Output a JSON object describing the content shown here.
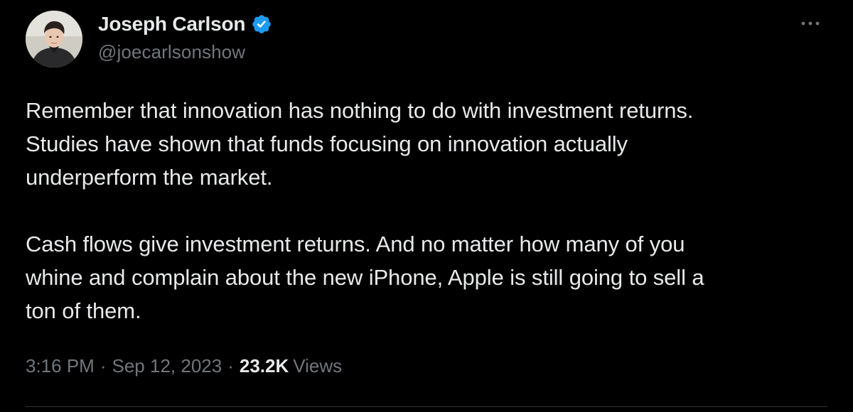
{
  "author": {
    "display_name": "Joseph Carlson",
    "handle": "@joecarlsonshow",
    "verified": true,
    "verified_color": "#1d9bf0"
  },
  "tweet": {
    "paragraphs": [
      "Remember that innovation has nothing to do with investment returns.\nStudies have shown that funds focusing on innovation actually\nunderperform the market.",
      "Cash flows give investment returns. And no matter how many of you\nwhine and complain about the new iPhone, Apple is still going to sell a\nton of them."
    ]
  },
  "meta": {
    "time": "3:16 PM",
    "date": "Sep 12, 2023",
    "separator": "·",
    "views_count": "23.2K",
    "views_label": "Views"
  },
  "icons": {
    "more": "more-horizontal-icon",
    "verified": "verified-badge-icon"
  },
  "colors": {
    "background": "#000000",
    "text_primary": "#e7e9ea",
    "text_secondary": "#71767b",
    "divider": "#2f3336"
  }
}
